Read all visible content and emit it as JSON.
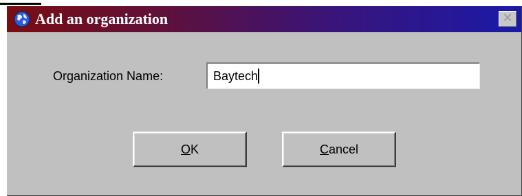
{
  "window": {
    "title": "Add an organization",
    "close_glyph": "✕",
    "title_icon": "globe-icon"
  },
  "form": {
    "organization_name_label": "Organization Name:",
    "organization_name_value": "Baytech"
  },
  "buttons": {
    "ok": {
      "accel": "O",
      "rest": "K"
    },
    "cancel": {
      "accel": "C",
      "rest": "ancel"
    }
  },
  "colors": {
    "titlebar_start": "#7a0d12",
    "titlebar_end": "#1a1aa8",
    "dialog_face": "#c0c0c0"
  }
}
